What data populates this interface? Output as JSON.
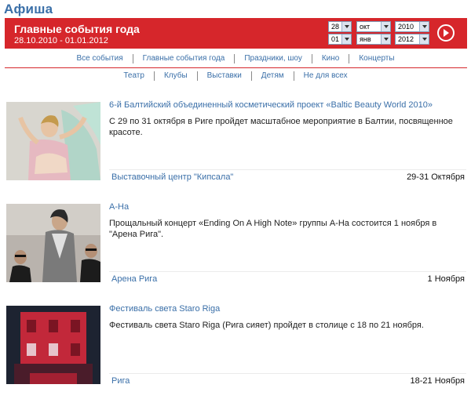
{
  "header": {
    "title": "Афиша"
  },
  "banner": {
    "title": "Главные события года",
    "range": "28.10.2010 - 01.01.2012",
    "from": {
      "day": "28",
      "month": "окт",
      "year": "2010"
    },
    "to": {
      "day": "01",
      "month": "янв",
      "year": "2012"
    },
    "accent": "#d6262b"
  },
  "nav": {
    "row1": [
      "Все события",
      "Главные события года",
      "Праздники, шоу",
      "Кино",
      "Концерты"
    ],
    "row2": [
      "Театр",
      "Клубы",
      "Выставки",
      "Детям",
      "Не для всех"
    ]
  },
  "events": [
    {
      "title": "6-й Балтийский объединенный косметический проект «Baltic Beauty World 2010»",
      "description": "С 29 по 31 октября в Риге пройдет масштабное мероприятие в Балтии, посвященное красоте.",
      "venue": "Выставочный центр \"Кипсала\"",
      "date": "29-31 Октября"
    },
    {
      "title": "A-Ha",
      "description": "Прощальный концерт «Ending On A High Note» группы А-На состоится 1 ноября в \"Арена Рига\".",
      "venue": "Арена Рига",
      "date": "1 Ноября"
    },
    {
      "title": "Фестиваль света Staro Riga",
      "description": "Фестиваль света Staro Riga (Рига сияет) пройдет в столице с 18 по 21 ноября.",
      "venue": "Рига",
      "date": "18-21 Ноября"
    }
  ]
}
